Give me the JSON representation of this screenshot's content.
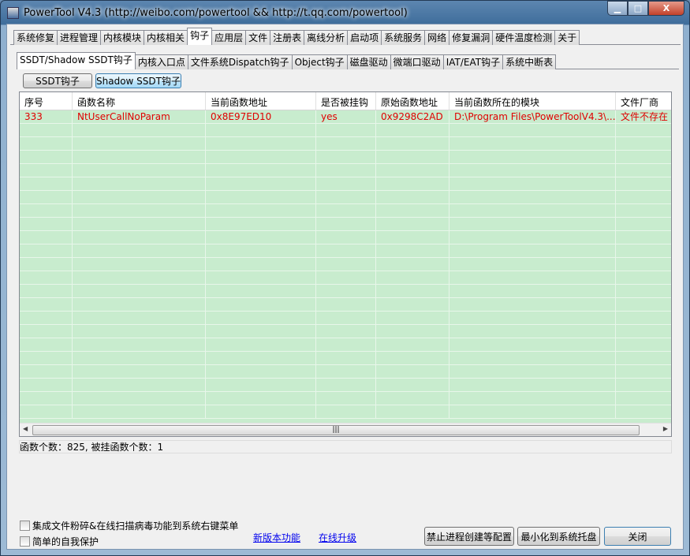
{
  "window": {
    "title": "PowerTool V4.3 (http://weibo.com/powertool && http://t.qq.com/powertool)",
    "minimize": "▁",
    "maximize": "□",
    "close": "X"
  },
  "main_tabs": [
    "系统修复",
    "进程管理",
    "内核模块",
    "内核相关",
    "钩子",
    "应用层",
    "文件",
    "注册表",
    "离线分析",
    "启动项",
    "系统服务",
    "网络",
    "修复漏洞",
    "硬件温度检测",
    "关于"
  ],
  "main_tab_active": 4,
  "sub_tabs": [
    "SSDT/Shadow SSDT钩子",
    "内核入口点",
    "文件系统Dispatch钩子",
    "Object钩子",
    "磁盘驱动",
    "微端口驱动",
    "IAT/EAT钩子",
    "系统中断表"
  ],
  "sub_tab_active": 0,
  "buttons": {
    "ssdt": "SSDT钩子",
    "shadow": "Shadow SSDT钩子"
  },
  "table": {
    "columns": [
      "序号",
      "函数名称",
      "当前函数地址",
      "是否被挂钩",
      "原始函数地址",
      "当前函数所在的模块",
      "文件厂商"
    ],
    "rows": [
      [
        "333",
        "NtUserCallNoParam",
        "0x8E97ED10",
        "yes",
        "0x9298C2AD",
        "D:\\Program Files\\PowerToolV4.3\\...",
        "文件不存在"
      ]
    ]
  },
  "status": "函数个数：825, 被挂函数个数：1",
  "footer": {
    "check1": "集成文件粉碎&在线扫描病毒功能到系统右键菜单",
    "check2": "简单的自我保护",
    "link1": "新版本功能",
    "link2": "在线升级",
    "btn1": "禁止进程创建等配置",
    "btn2": "最小化到系统托盘",
    "btn3": "关闭"
  }
}
